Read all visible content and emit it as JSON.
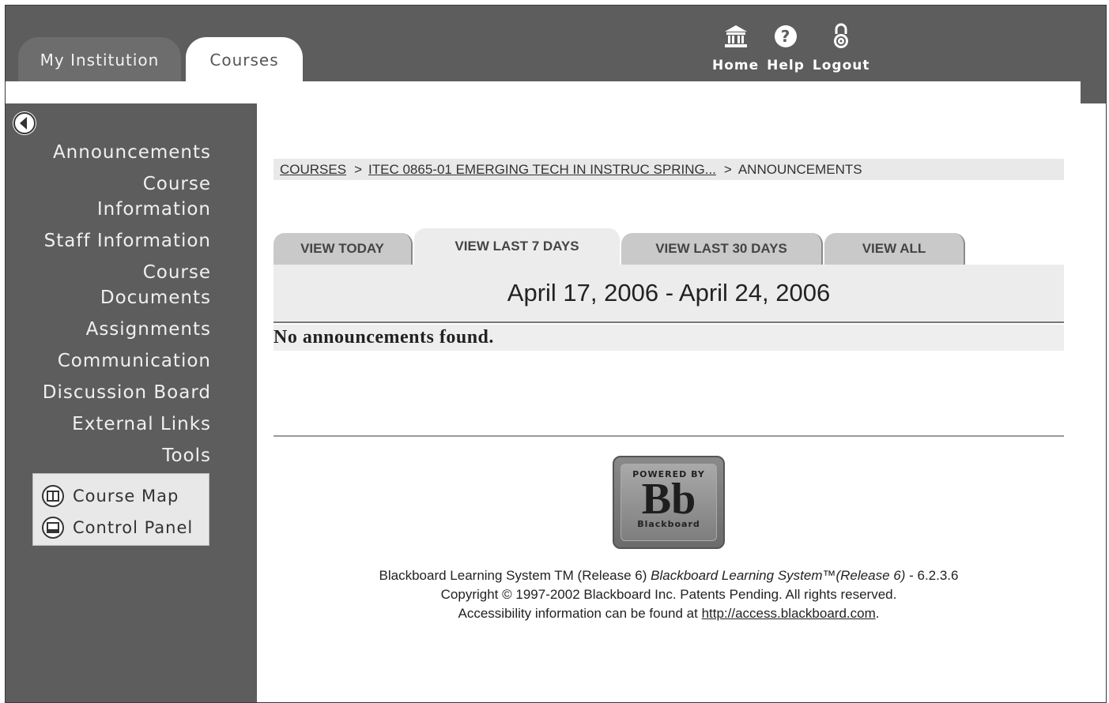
{
  "top_tabs": {
    "my_institution": "My Institution",
    "courses": "Courses"
  },
  "header_links": {
    "home": "Home",
    "help": "Help",
    "logout": "Logout"
  },
  "sidebar": {
    "items": [
      "Announcements",
      "Course\nInformation",
      "Staff Information",
      "Course\nDocuments",
      "Assignments",
      "Communication",
      "Discussion Board",
      "External Links",
      "Tools"
    ],
    "tools": {
      "course_map": "Course Map",
      "control_panel": "Control Panel"
    }
  },
  "breadcrumb": {
    "courses": "COURSES",
    "course": "ITEC 0865-01 EMERGING TECH IN INSTRUC SPRING...",
    "current": "ANNOUNCEMENTS",
    "separator": ">"
  },
  "view_tabs": {
    "today": "VIEW TODAY",
    "last7": "VIEW LAST 7 DAYS",
    "last30": "VIEW LAST 30 DAYS",
    "all": "VIEW ALL",
    "active": "last7"
  },
  "date_range": "April 17, 2006 - April 24, 2006",
  "empty_message": "No announcements found.",
  "logo": {
    "powered_by": "POWERED BY",
    "mark": "Bb",
    "name": "Blackboard"
  },
  "footer": {
    "line1_a": "Blackboard Learning System TM (Release 6)",
    "line1_b": "Blackboard Learning System™(Release 6)",
    "line1_c": "- 6.2.3.6",
    "line2": "Copyright © 1997-2002 Blackboard Inc. Patents Pending. All rights reserved.",
    "line3": "Accessibility information can be found at",
    "link": "http://access.blackboard.com",
    "period": "."
  },
  "colors": {
    "frame": "#5d5d5d",
    "content": "#ffffff",
    "panel": "#ececec",
    "inactive_tab": "#c9c9c9"
  }
}
